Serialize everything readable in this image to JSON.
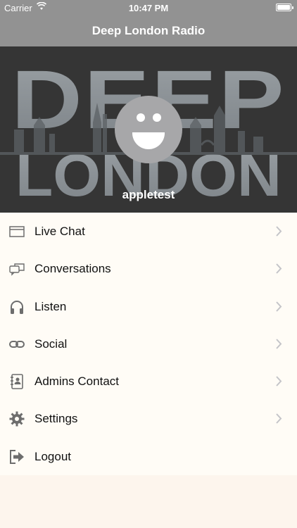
{
  "status_bar": {
    "carrier": "Carrier",
    "time": "10:47 PM"
  },
  "nav": {
    "title": "Deep London Radio"
  },
  "header": {
    "logo_line1": "DEEP",
    "logo_line2": "LONDON",
    "username": "appletest"
  },
  "menu": [
    {
      "label": "Live Chat",
      "icon": "chat-window-icon",
      "chevron": true
    },
    {
      "label": "Conversations",
      "icon": "speech-bubbles-icon",
      "chevron": true
    },
    {
      "label": "Listen",
      "icon": "headphones-icon",
      "chevron": true
    },
    {
      "label": "Social",
      "icon": "link-icon",
      "chevron": true
    },
    {
      "label": "Admins Contact",
      "icon": "contact-book-icon",
      "chevron": true
    },
    {
      "label": "Settings",
      "icon": "gear-icon",
      "chevron": true
    },
    {
      "label": "Logout",
      "icon": "logout-icon",
      "chevron": false
    }
  ],
  "colors": {
    "bar": "#929292",
    "header_bg": "#353535",
    "menu_bg": "#fffcf6",
    "icon": "#6d6d6d"
  }
}
